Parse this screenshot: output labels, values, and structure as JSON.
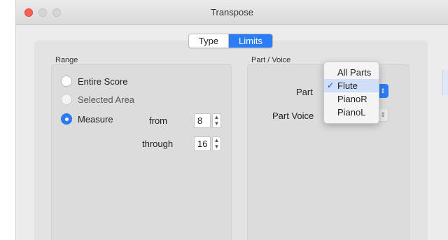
{
  "window": {
    "title": "Transpose"
  },
  "tabs": {
    "type_label": "Type",
    "limits_label": "Limits",
    "selected": "Limits"
  },
  "range": {
    "title": "Range",
    "options": [
      "Entire Score",
      "Selected Area",
      "Measure"
    ],
    "selected": "Measure",
    "from_label": "from",
    "from_value": "8",
    "through_label": "through",
    "through_value": "16"
  },
  "part_voice": {
    "title": "Part / Voice",
    "part_label": "Part",
    "part_voice_label": "Part Voice",
    "part_menu": {
      "items": [
        "All Parts",
        "Flute",
        "PianoR",
        "PianoL"
      ],
      "selected": "Flute"
    }
  },
  "colors": {
    "accent": "#2c7cf6",
    "close_button": "#ff5f57",
    "window_bg": "#ececec"
  },
  "icons": {
    "check": "✓",
    "stepper_up": "▲",
    "stepper_down": "▼",
    "popup_arrows": "⇕"
  }
}
